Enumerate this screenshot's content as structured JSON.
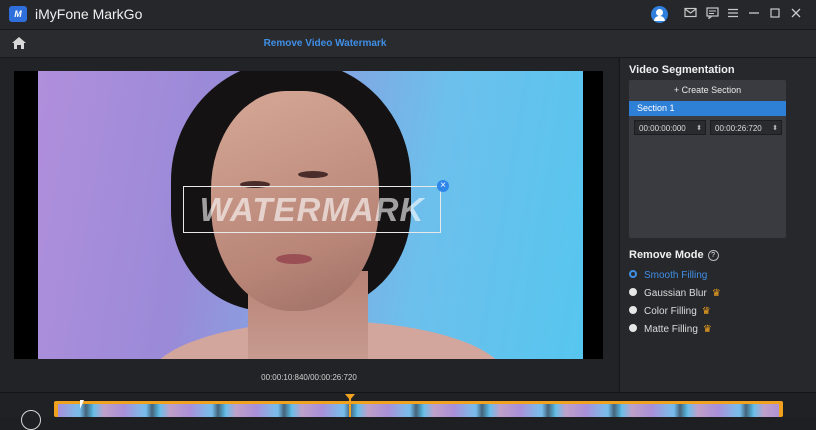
{
  "app": {
    "title": "iMyFone MarkGo",
    "logo_text": "M"
  },
  "window_controls": [
    "mail-icon",
    "feedback-icon",
    "menu-icon",
    "minimize-icon",
    "maximize-icon",
    "close-icon"
  ],
  "header": {
    "title": "Remove Video Watermark"
  },
  "preview": {
    "watermark_text": "WATERMARK",
    "timecode": "00:00:10:840/00:00:26:720"
  },
  "segmentation": {
    "title": "Video Segmentation",
    "create_label": "+ Create Section",
    "sections": [
      {
        "label": "Section 1",
        "start": "00:00:00:000",
        "end": "00:00:26:720"
      }
    ]
  },
  "remove_mode": {
    "title": "Remove Mode",
    "options": [
      {
        "label": "Smooth Filling",
        "selected": true,
        "premium": false
      },
      {
        "label": "Gaussian Blur",
        "selected": false,
        "premium": true
      },
      {
        "label": "Color Filling",
        "selected": false,
        "premium": true
      },
      {
        "label": "Matte Filling",
        "selected": false,
        "premium": true
      }
    ]
  },
  "colors": {
    "accent": "#3f8fe6",
    "timeline": "#f0a21f",
    "background": "#1e1f22"
  }
}
